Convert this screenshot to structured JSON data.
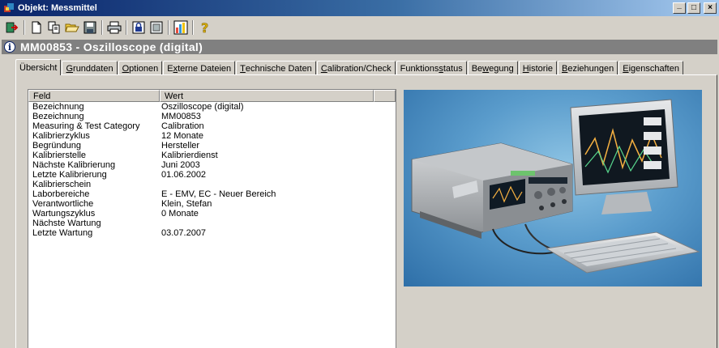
{
  "window": {
    "title": "Objekt: Messmittel",
    "buttons": [
      "_",
      "□",
      "×"
    ]
  },
  "object_header": {
    "title": "MM00853 - Oszilloscope (digital)"
  },
  "tabs": [
    {
      "pre": "Übersicht",
      "key": "",
      "post": "",
      "active": true
    },
    {
      "pre": "",
      "key": "G",
      "post": "runddaten",
      "active": false
    },
    {
      "pre": "",
      "key": "O",
      "post": "ptionen",
      "active": false
    },
    {
      "pre": "E",
      "key": "x",
      "post": "terne Dateien",
      "active": false
    },
    {
      "pre": "",
      "key": "T",
      "post": "echnische Daten",
      "active": false
    },
    {
      "pre": "",
      "key": "C",
      "post": "alibration/Check",
      "active": false
    },
    {
      "pre": "Funktions",
      "key": "s",
      "post": "tatus",
      "active": false
    },
    {
      "pre": "Be",
      "key": "w",
      "post": "egung",
      "active": false
    },
    {
      "pre": "",
      "key": "H",
      "post": "istorie",
      "active": false
    },
    {
      "pre": "",
      "key": "B",
      "post": "eziehungen",
      "active": false
    },
    {
      "pre": "",
      "key": "E",
      "post": "igenschaften",
      "active": false
    }
  ],
  "grid": {
    "columns": [
      "Feld",
      "Wert"
    ],
    "rows": [
      {
        "field": "Bezeichnung",
        "value": "Oszilloscope (digital)"
      },
      {
        "field": "Bezeichnung",
        "value": "MM00853"
      },
      {
        "field": "Measuring & Test Category",
        "value": "Calibration"
      },
      {
        "field": "Kalibrierzyklus",
        "value": "12 Monate"
      },
      {
        "field": "Begründung",
        "value": "Hersteller"
      },
      {
        "field": "Kalibrierstelle",
        "value": "Kalibrierdienst"
      },
      {
        "field": "Nächste Kalibrierung",
        "value": "Juni 2003"
      },
      {
        "field": "Letzte Kalibrierung",
        "value": "01.06.2002"
      },
      {
        "field": "Kalibrierschein",
        "value": ""
      },
      {
        "field": "Laborbereiche",
        "value": "E - EMV, EC - Neuer Bereich"
      },
      {
        "field": "Verantwortliche",
        "value": "Klein, Stefan"
      },
      {
        "field": "Wartungszyklus",
        "value": "0 Monate"
      },
      {
        "field": "Nächste Wartung",
        "value": ""
      },
      {
        "field": "Letzte Wartung",
        "value": "03.07.2007"
      }
    ]
  },
  "toolbar_icons": [
    "exit-icon",
    "new-document-icon",
    "copy-icon",
    "open-folder-icon",
    "save-icon",
    "print-icon",
    "lock-icon",
    "form-icon",
    "chart-icon",
    "help-icon"
  ],
  "colors": {
    "titlebar": "#0a246a",
    "object_bar": "#808080",
    "face": "#d4d0c8"
  }
}
